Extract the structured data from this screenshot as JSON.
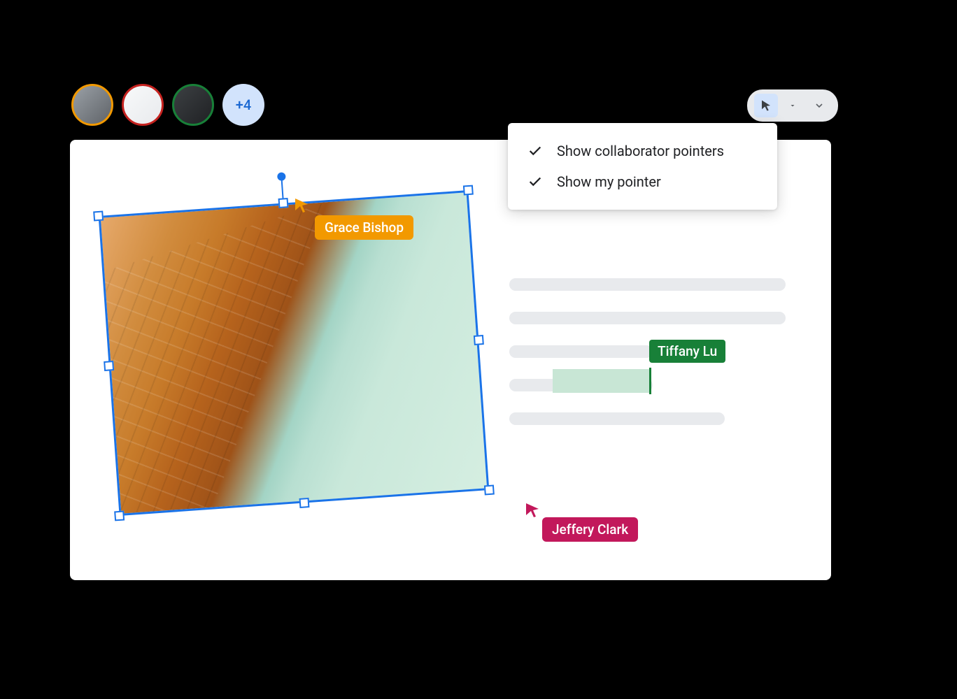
{
  "avatars": {
    "overflow_label": "+4",
    "ring_colors": [
      "#f29900",
      "#c2185b",
      "#188038"
    ]
  },
  "toolbar": {
    "pointer_active": true
  },
  "dropdown": {
    "items": [
      {
        "label": "Show collaborator pointers",
        "checked": true
      },
      {
        "label": "Show my pointer",
        "checked": true
      }
    ]
  },
  "collaborators": {
    "grace": {
      "name": "Grace Bishop",
      "color": "#f29900"
    },
    "tiffany": {
      "name": "Tiffany Lu",
      "color": "#188038"
    },
    "jeffery": {
      "name": "Jeffery Clark",
      "color": "#c2185b"
    }
  }
}
